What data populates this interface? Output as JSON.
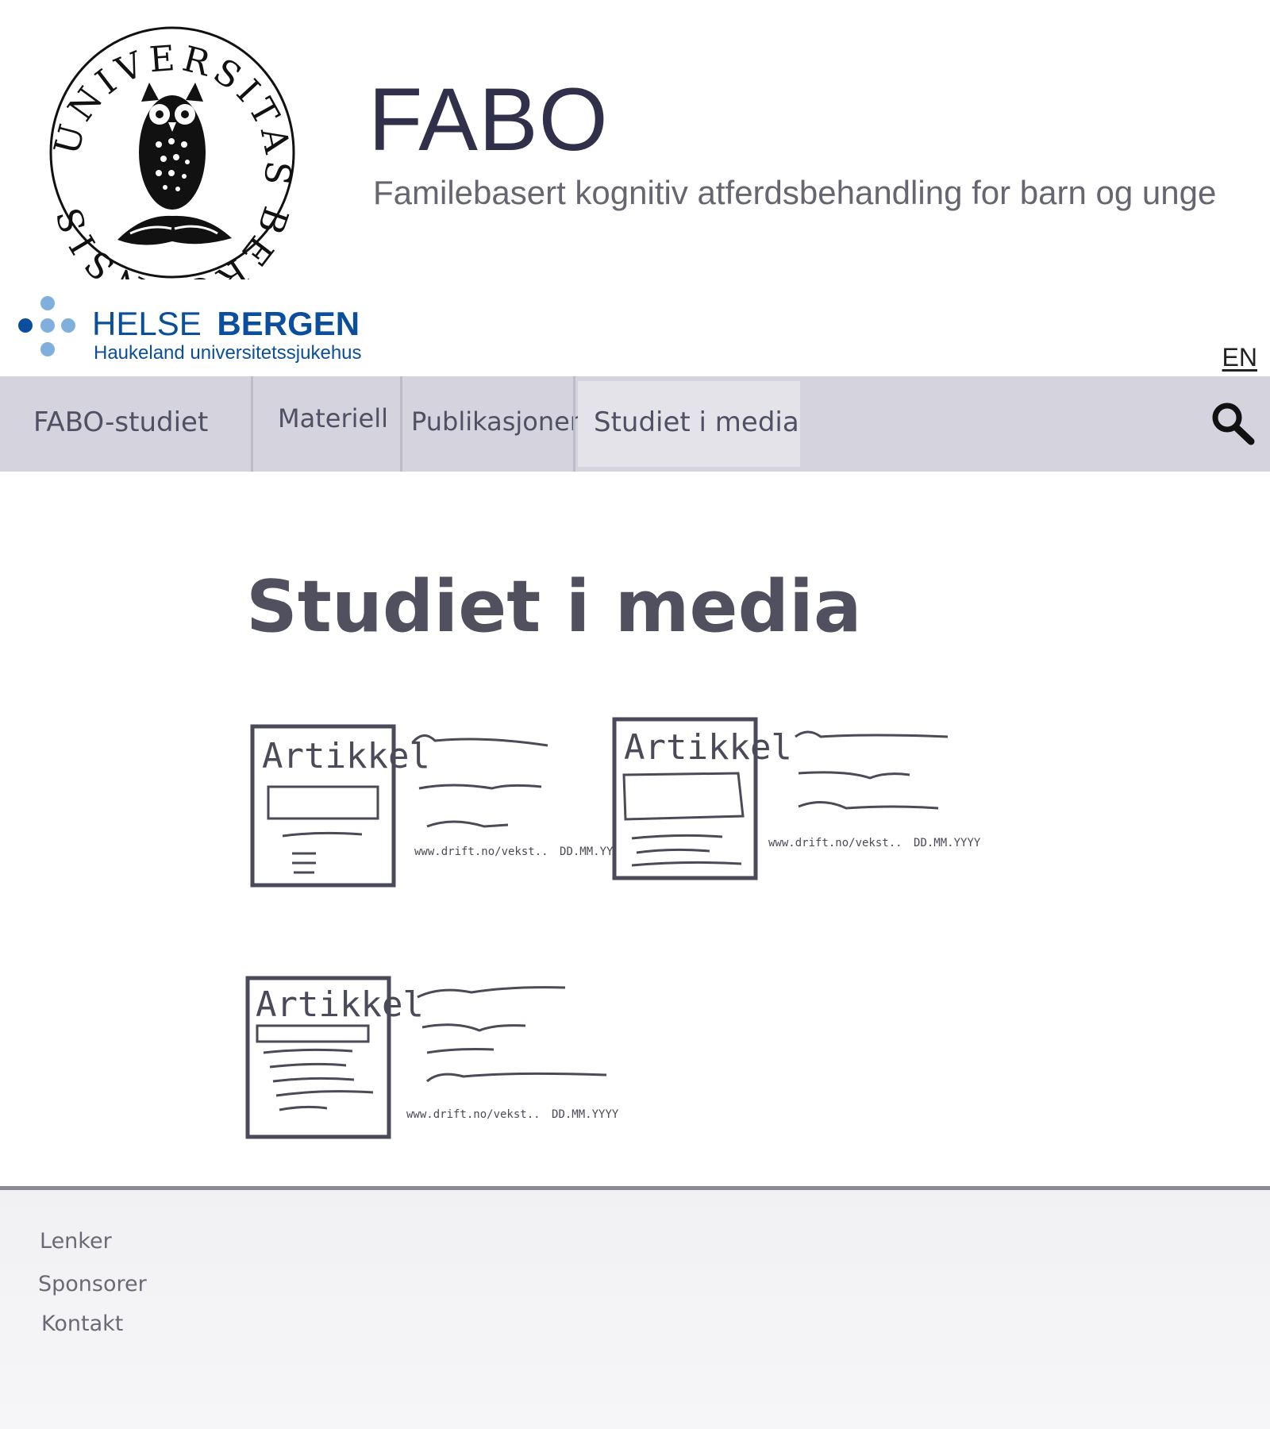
{
  "header": {
    "seal_text": "UNIVERSITAS BERGENSIS",
    "site_title": "FABO",
    "site_subtitle": "Familebasert kognitiv atferdsbehandling for barn og unge",
    "partner": {
      "name_light": "HELSE",
      "name_bold": "BERGEN",
      "tagline": "Haukeland universitetssjukehus"
    },
    "language_link": "EN"
  },
  "nav": {
    "items": [
      {
        "label": "FABO-studiet"
      },
      {
        "label": "Materiell"
      },
      {
        "label": "Publikasjoner"
      },
      {
        "label": "Studiet i media"
      }
    ],
    "active_index": 3
  },
  "main": {
    "heading": "Studiet i media",
    "articles": [
      {
        "thumb_label": "Artikkel",
        "url": "www.drift.no/vekst..",
        "date": "DD.MM.YYYY"
      },
      {
        "thumb_label": "Artikkel",
        "url": "www.drift.no/vekst..",
        "date": "DD.MM.YYYY"
      },
      {
        "thumb_label": "Artikkel",
        "url": "www.drift.no/vekst..",
        "date": "DD.MM.YYYY"
      }
    ]
  },
  "footer": {
    "links": [
      {
        "label": "Lenker"
      },
      {
        "label": "Sponsorer"
      },
      {
        "label": "Kontakt"
      }
    ]
  },
  "colors": {
    "nav_background": "#d4d3de",
    "nav_active": "#e4e3ea",
    "helse_dark_blue": "#0b4f9c",
    "helse_light_blue": "#7fb0dd",
    "title": "#30304a",
    "sketch_ink": "#4a4a58"
  }
}
